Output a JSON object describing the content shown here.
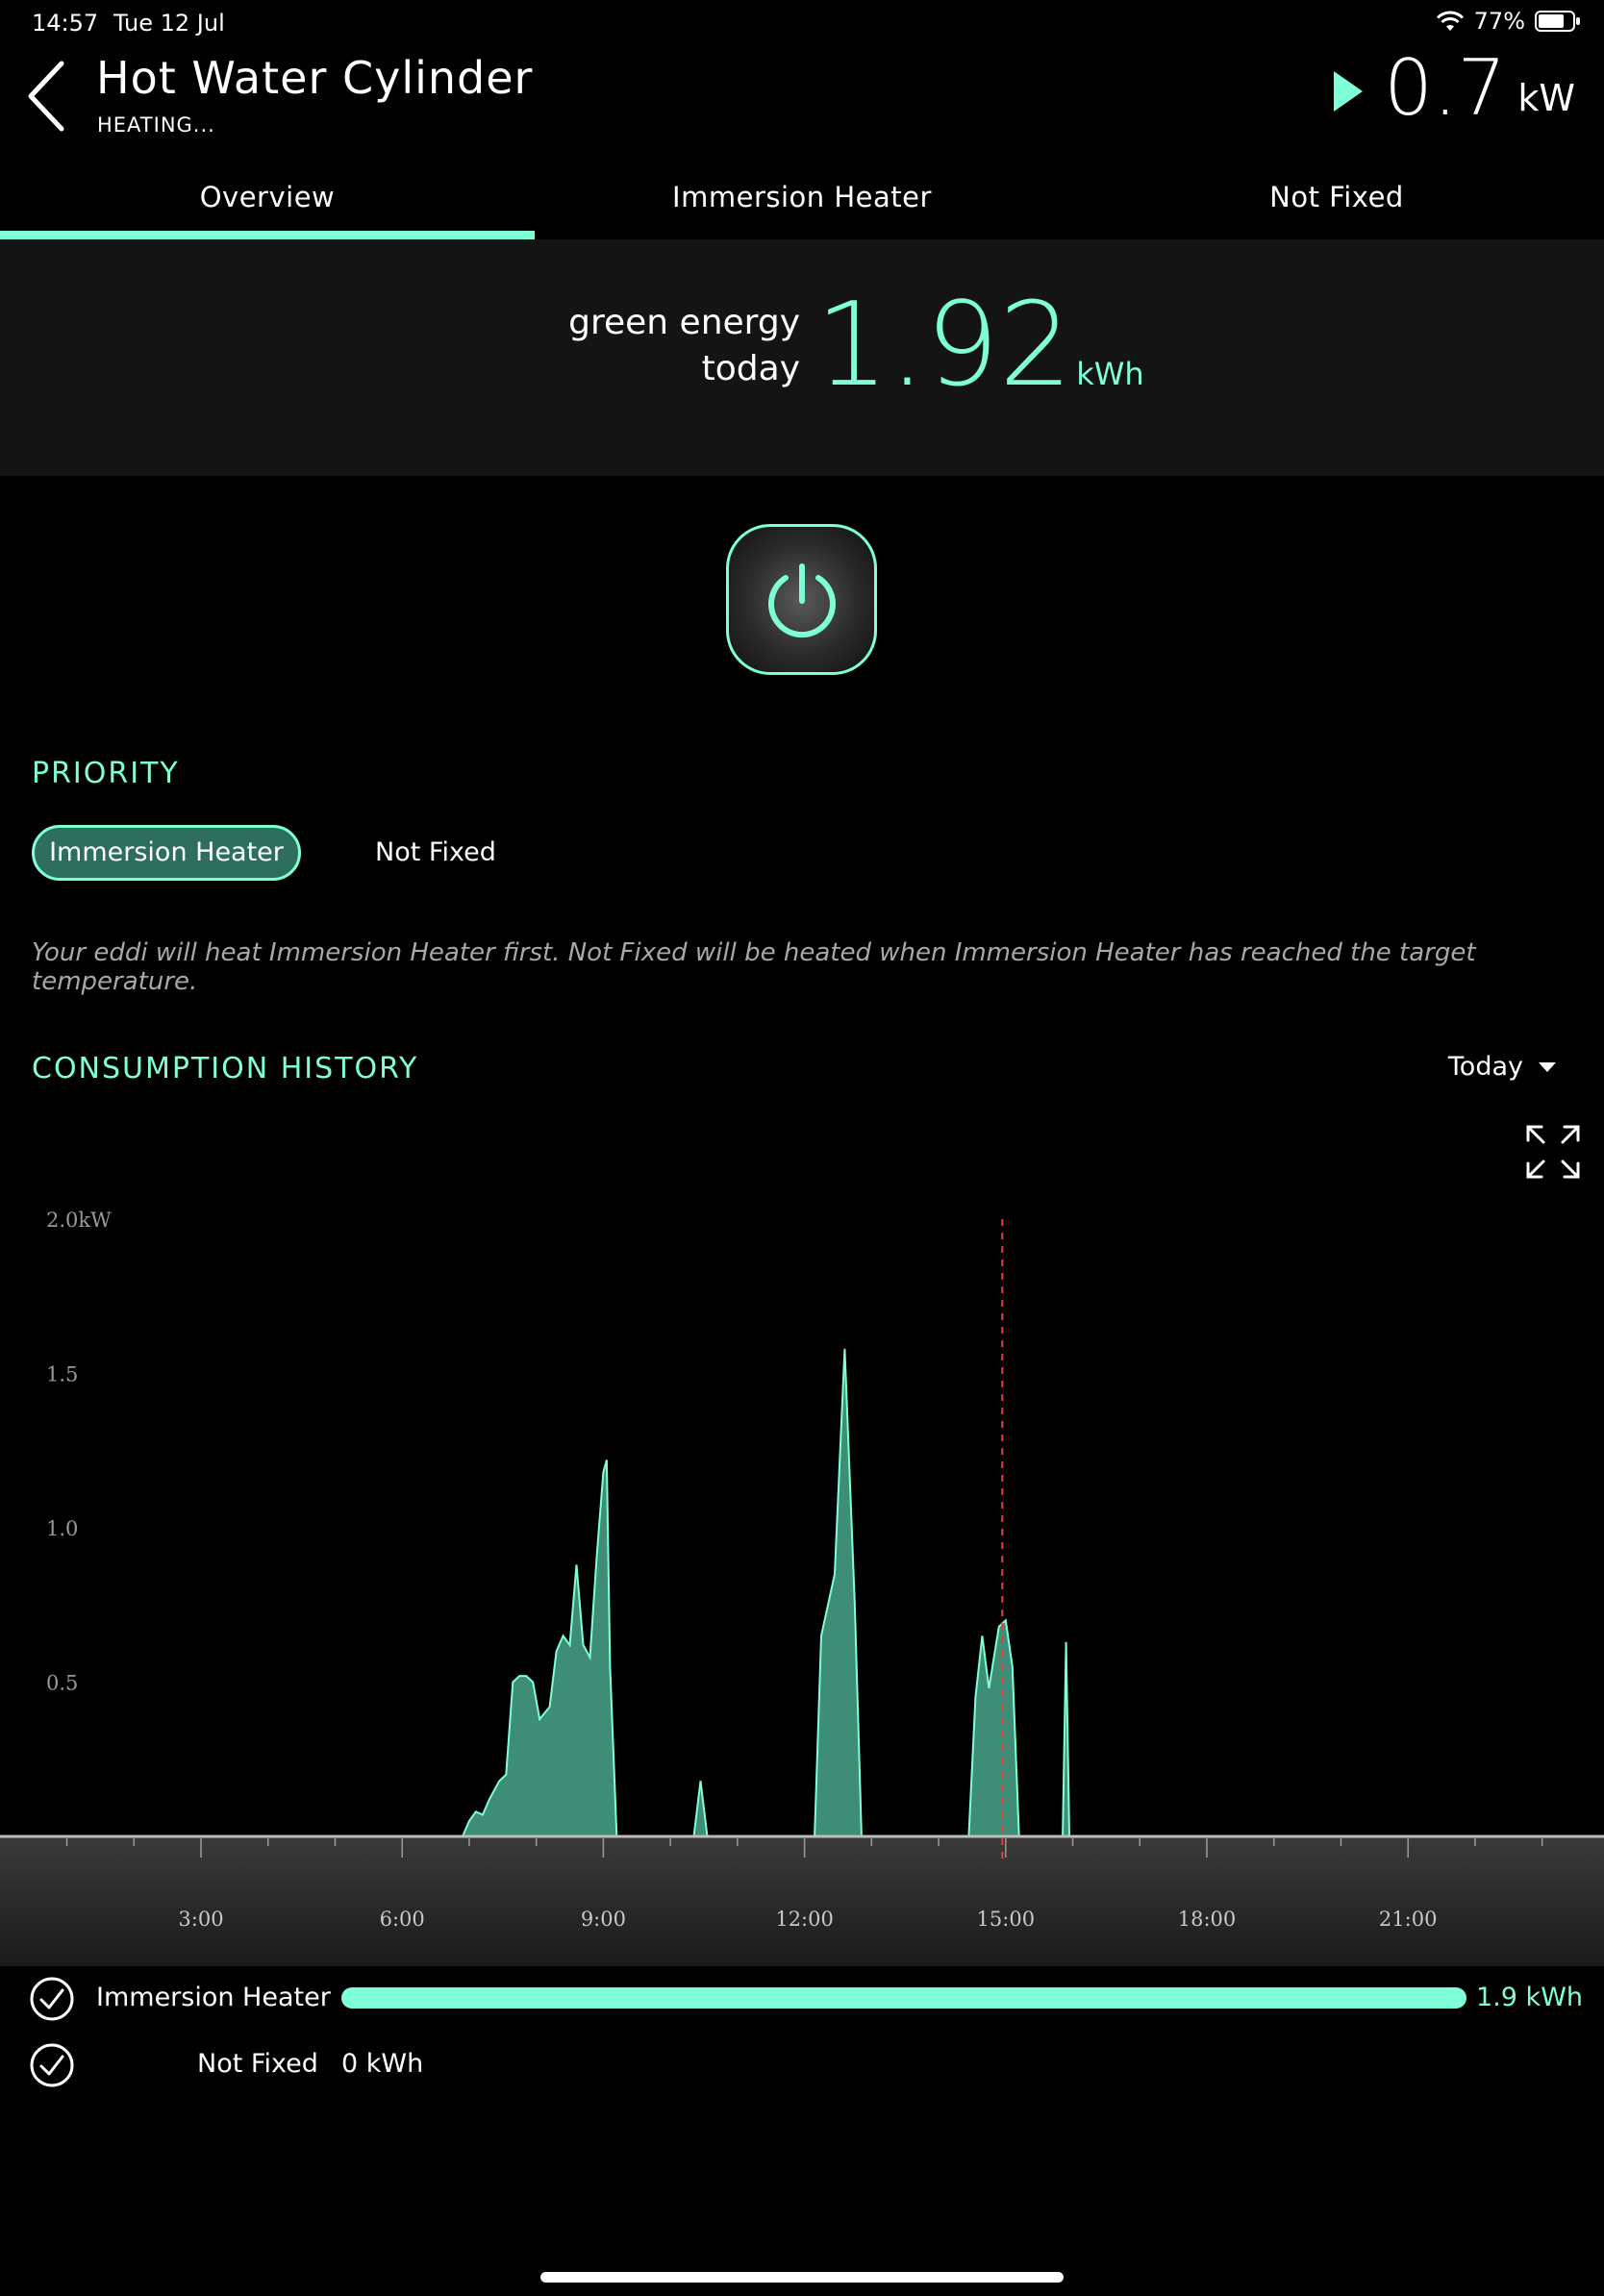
{
  "status": {
    "time": "14:57",
    "date": "Tue 12 Jul",
    "battery": "77%",
    "battery_level": 0.77
  },
  "header": {
    "title": "Hot Water Cylinder",
    "subtitle": "HEATING...",
    "power_value": "0.7",
    "power_unit": "kW"
  },
  "tabs": [
    {
      "label": "Overview",
      "active": true
    },
    {
      "label": "Immersion Heater"
    },
    {
      "label": "Not Fixed"
    }
  ],
  "green_energy": {
    "label_line1": "green energy",
    "label_line2": "today",
    "value_int": "1",
    "value_dec": ".92",
    "unit": "kWh"
  },
  "priority": {
    "title": "PRIORITY",
    "selected": "Immersion Heater",
    "other": "Not Fixed",
    "description": "Your eddi will heat Immersion Heater first. Not Fixed will be heated when Immersion Heater has reached the target temperature."
  },
  "consumption": {
    "title": "CONSUMPTION HISTORY",
    "range": "Today"
  },
  "chart_data": {
    "type": "area",
    "x_unit": "hours",
    "x": [
      0,
      6.9,
      7.1,
      7.3,
      7.6,
      7.7,
      7.8,
      7.95,
      8.05,
      8.2,
      8.3,
      8.45,
      8.55,
      8.65,
      8.75,
      8.85,
      9.0,
      9.05,
      10.4,
      10.45,
      10.55,
      12.15,
      12.3,
      12.5,
      12.65,
      12.95,
      14.3,
      14.4,
      14.55,
      14.65,
      14.75,
      14.9,
      15.05,
      14.95,
      15.0,
      15.05,
      15.1
    ],
    "series": [
      {
        "values": [
          [
            6.9,
            0
          ],
          [
            7.0,
            0.05
          ],
          [
            7.1,
            0.08
          ],
          [
            7.2,
            0.07
          ],
          [
            7.3,
            0.12
          ],
          [
            7.45,
            0.18
          ],
          [
            7.55,
            0.2
          ],
          [
            7.65,
            0.5
          ],
          [
            7.75,
            0.52
          ],
          [
            7.85,
            0.52
          ],
          [
            7.95,
            0.5
          ],
          [
            8.05,
            0.38
          ],
          [
            8.2,
            0.42
          ],
          [
            8.3,
            0.6
          ],
          [
            8.4,
            0.65
          ],
          [
            8.5,
            0.62
          ],
          [
            8.6,
            0.88
          ],
          [
            8.7,
            0.62
          ],
          [
            8.8,
            0.58
          ],
          [
            8.9,
            0.9
          ],
          [
            9.0,
            1.18
          ],
          [
            9.05,
            1.22
          ],
          [
            9.1,
            0.55
          ],
          [
            9.2,
            0
          ],
          [
            10.35,
            0
          ],
          [
            10.45,
            0.18
          ],
          [
            10.55,
            0
          ],
          [
            12.15,
            0
          ],
          [
            12.25,
            0.65
          ],
          [
            12.45,
            0.85
          ],
          [
            12.6,
            1.58
          ],
          [
            12.75,
            0.75
          ],
          [
            12.85,
            0
          ],
          [
            14.45,
            0
          ],
          [
            14.55,
            0.45
          ],
          [
            14.65,
            0.65
          ],
          [
            14.75,
            0.48
          ],
          [
            14.9,
            0.68
          ],
          [
            15.0,
            0.7
          ],
          [
            15.1,
            0.55
          ],
          [
            15.2,
            0
          ],
          [
            15.85,
            0
          ],
          [
            15.9,
            0.63
          ],
          [
            15.95,
            0
          ]
        ]
      }
    ],
    "y_ticks": [
      "0.5",
      "1.0",
      "1.5",
      "2.0kW"
    ],
    "x_ticks": [
      "3:00",
      "6:00",
      "9:00",
      "12:00",
      "15:00",
      "18:00",
      "21:00"
    ],
    "ylim": [
      0,
      2.0
    ],
    "xlim": [
      0,
      24
    ],
    "now_marker": 14.95,
    "colors": {
      "fill": "#3e8d76",
      "stroke": "#7effd8",
      "marker": "#e0433a"
    }
  },
  "legend": [
    {
      "name": "Immersion Heater",
      "value": "1.9 kWh",
      "fraction": 1.0
    },
    {
      "name": "Not Fixed",
      "value": "0 kWh",
      "fraction": 0
    }
  ],
  "colors": {
    "accent": "#7effd8",
    "panel": "#141414",
    "background": "#000000"
  },
  "icons": [
    "back-chevron-icon",
    "play-triangle-icon",
    "power-icon",
    "expand-icon",
    "check-circle-icon",
    "dropdown-caret-icon",
    "wifi-icon",
    "battery-icon"
  ]
}
